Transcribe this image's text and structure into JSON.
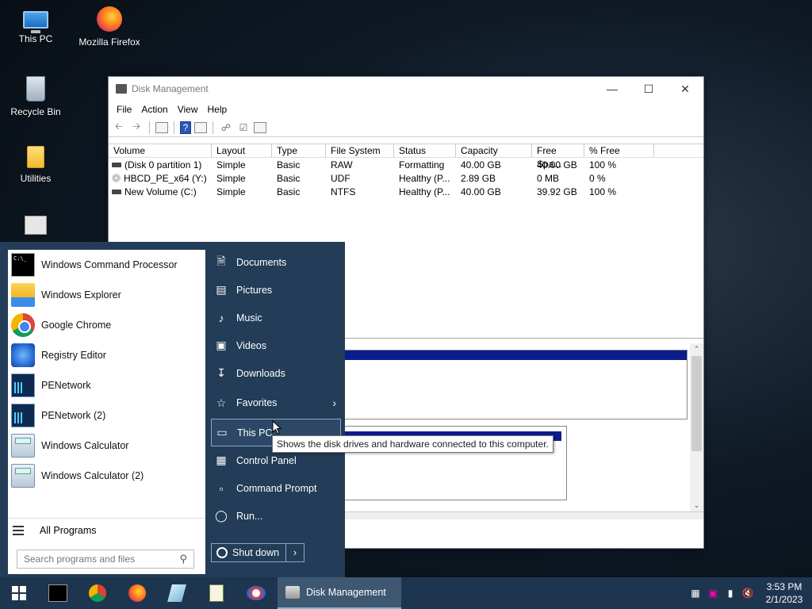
{
  "desktop": {
    "icons": [
      {
        "label": "This PC",
        "icon": "this-pc-icon"
      },
      {
        "label": "Mozilla Firefox",
        "icon": "firefox-icon"
      },
      {
        "label": "Recycle Bin",
        "icon": "recycle-bin-icon"
      },
      {
        "label": "Utilities",
        "icon": "folder-icon"
      }
    ]
  },
  "window": {
    "title": "Disk Management",
    "menu": [
      "File",
      "Action",
      "View",
      "Help"
    ],
    "columns": [
      "Volume",
      "Layout",
      "Type",
      "File System",
      "Status",
      "Capacity",
      "Free Spa...",
      "% Free"
    ],
    "rows": [
      [
        "(Disk 0 partition 1)",
        "Simple",
        "Basic",
        "RAW",
        "Formatting",
        "40.00 GB",
        "40.00 GB",
        "100 %"
      ],
      [
        "HBCD_PE_x64 (Y:)",
        "Simple",
        "Basic",
        "UDF",
        "Healthy (P...",
        "2.89 GB",
        "0 MB",
        "0 %"
      ],
      [
        "New Volume (C:)",
        "Simple",
        "Basic",
        "NTFS",
        "Healthy (P...",
        "40.00 GB",
        "39.92 GB",
        "100 %"
      ]
    ]
  },
  "start_menu": {
    "programs": [
      {
        "label": "Windows Command Processor",
        "icon": "cmd-icon"
      },
      {
        "label": "Windows Explorer",
        "icon": "explorer-icon"
      },
      {
        "label": "Google Chrome",
        "icon": "chrome-icon"
      },
      {
        "label": "Registry Editor",
        "icon": "registry-icon"
      },
      {
        "label": "PENetwork",
        "icon": "network-icon"
      },
      {
        "label": "PENetwork (2)",
        "icon": "network-icon"
      },
      {
        "label": "Windows Calculator",
        "icon": "calculator-icon"
      },
      {
        "label": "Windows Calculator (2)",
        "icon": "calculator-icon"
      }
    ],
    "all_programs": "All Programs",
    "search_placeholder": "Search programs and files",
    "right_items": [
      {
        "label": "Documents",
        "icon": "document-icon"
      },
      {
        "label": "Pictures",
        "icon": "picture-icon"
      },
      {
        "label": "Music",
        "icon": "music-icon"
      },
      {
        "label": "Videos",
        "icon": "video-icon"
      },
      {
        "label": "Downloads",
        "icon": "download-icon"
      },
      {
        "label": "Favorites",
        "icon": "star-icon"
      },
      {
        "label": "This PC",
        "icon": "monitor-icon"
      },
      {
        "label": "Control Panel",
        "icon": "control-panel-icon"
      },
      {
        "label": "Command Prompt",
        "icon": "cmd-prompt-icon"
      },
      {
        "label": "Run...",
        "icon": "run-icon"
      }
    ],
    "shutdown": "Shut down",
    "tooltip": "Shows the disk drives and hardware connected to this computer."
  },
  "taskbar": {
    "task_label": "Disk Management",
    "time": "3:53 PM",
    "date": "2/1/2023"
  }
}
